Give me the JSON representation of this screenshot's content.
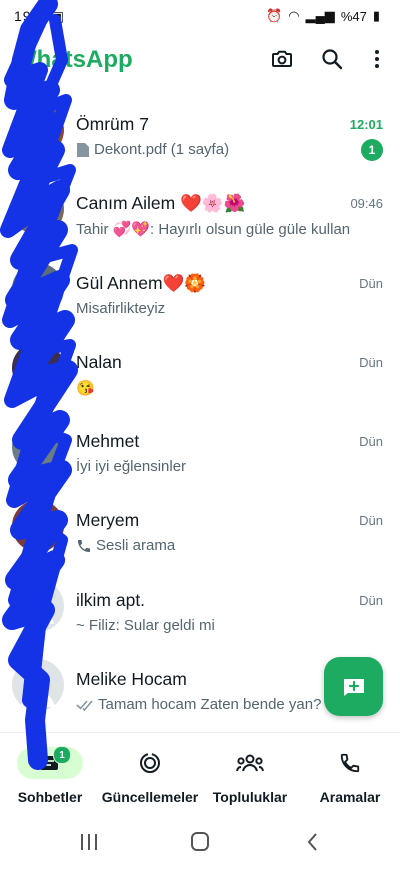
{
  "status_bar": {
    "left_text": "19 ◙ ▣",
    "battery": "%47"
  },
  "app": {
    "title": "WhatsApp"
  },
  "colors": {
    "brand": "#1daa61",
    "scribble": "#1433e6"
  },
  "chats": [
    {
      "name": "Ömrüm 7",
      "preview": "Dekont.pdf (1 sayfa)",
      "preview_icon": "document-icon",
      "time": "12:01",
      "unread": "1"
    },
    {
      "name": "Canım Ailem ❤️🌸🌺",
      "preview": "Tahir 💞💖: Hayırlı olsun güle güle kullan",
      "time": "09:46"
    },
    {
      "name": "Gül Annem❤️🏵️",
      "preview": "Misafirlikteyiz",
      "time": "Dün"
    },
    {
      "name": "Nalan",
      "preview": "😘",
      "time": "Dün"
    },
    {
      "name": "Mehmet",
      "preview": "İyi iyi eğlensinler",
      "time": "Dün"
    },
    {
      "name": "Meryem",
      "preview": "Sesli arama",
      "preview_icon": "voice-call-icon",
      "time": "Dün"
    },
    {
      "name": "ilkim apt.",
      "preview": "~ Filiz: Sular geldi mi",
      "time": "Dün"
    },
    {
      "name": "Melike Hocam",
      "preview": "Tamam hocam  Zaten bende yan?",
      "preview_icon": "double-check-icon",
      "time": ""
    }
  ],
  "nav": {
    "chats": {
      "label": "Sohbetler",
      "badge": "1"
    },
    "updates": {
      "label": "Güncellemeler"
    },
    "communities": {
      "label": "Topluluklar"
    },
    "calls": {
      "label": "Aramalar"
    }
  }
}
